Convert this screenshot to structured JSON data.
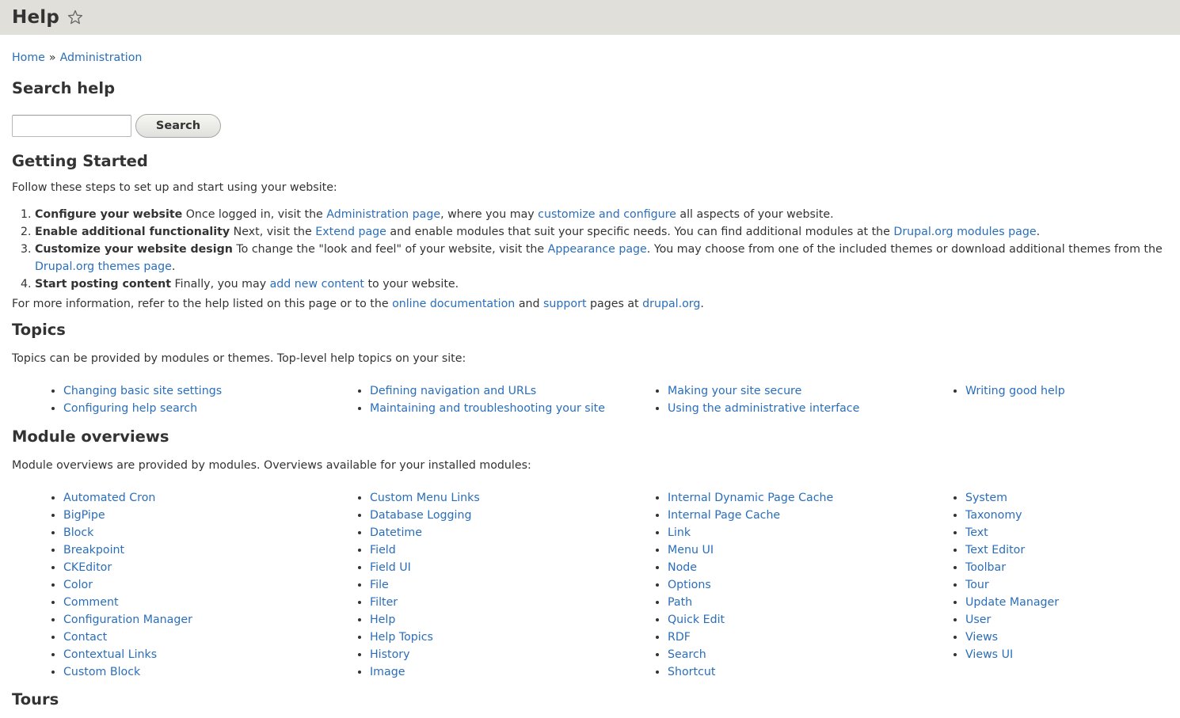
{
  "header": {
    "title": "Help",
    "star_icon": "star-outline-icon"
  },
  "breadcrumb": {
    "home": "Home",
    "separator": "»",
    "admin": "Administration"
  },
  "search": {
    "heading": "Search help",
    "button_label": "Search",
    "value": ""
  },
  "getting_started": {
    "heading": "Getting Started",
    "intro": "Follow these steps to set up and start using your website:",
    "steps": [
      {
        "title": "Configure your website",
        "t1": " Once logged in, visit the ",
        "l1": "Administration page",
        "t2": ", where you may ",
        "l2": "customize and configure",
        "t3": " all aspects of your website."
      },
      {
        "title": "Enable additional functionality",
        "t1": " Next, visit the ",
        "l1": "Extend page",
        "t2": " and enable modules that suit your specific needs. You can find additional modules at the ",
        "l2": "Drupal.org modules page",
        "t3": "."
      },
      {
        "title": "Customize your website design",
        "t1": " To change the \"look and feel\" of your website, visit the ",
        "l1": "Appearance page",
        "t2": ". You may choose from one of the included themes or download additional themes from the ",
        "l2": "Drupal.org themes page",
        "t3": "."
      },
      {
        "title": "Start posting content",
        "t1": " Finally, you may ",
        "l1": "add new content",
        "t2": " to your website."
      }
    ],
    "more": {
      "t1": "For more information, refer to the help listed on this page or to the ",
      "l1": "online documentation",
      "t2": " and ",
      "l2": "support",
      "t3": " pages at ",
      "l3": "drupal.org",
      "t4": "."
    }
  },
  "topics": {
    "heading": "Topics",
    "intro": "Topics can be provided by modules or themes. Top-level help topics on your site:",
    "items": [
      "Changing basic site settings",
      "Configuring help search",
      "Defining navigation and URLs",
      "Maintaining and troubleshooting your site",
      "Making your site secure",
      "Using the administrative interface",
      "Writing good help"
    ]
  },
  "modules": {
    "heading": "Module overviews",
    "intro": "Module overviews are provided by modules. Overviews available for your installed modules:",
    "items": [
      "Automated Cron",
      "BigPipe",
      "Block",
      "Breakpoint",
      "CKEditor",
      "Color",
      "Comment",
      "Configuration Manager",
      "Contact",
      "Contextual Links",
      "Custom Block",
      "Custom Menu Links",
      "Database Logging",
      "Datetime",
      "Field",
      "Field UI",
      "File",
      "Filter",
      "Help",
      "Help Topics",
      "History",
      "Image",
      "Internal Dynamic Page Cache",
      "Internal Page Cache",
      "Link",
      "Menu UI",
      "Node",
      "Options",
      "Path",
      "Quick Edit",
      "RDF",
      "Search",
      "Shortcut",
      "System",
      "Taxonomy",
      "Text",
      "Text Editor",
      "Toolbar",
      "Tour",
      "Update Manager",
      "User",
      "Views",
      "Views UI"
    ]
  },
  "tours": {
    "heading": "Tours"
  }
}
